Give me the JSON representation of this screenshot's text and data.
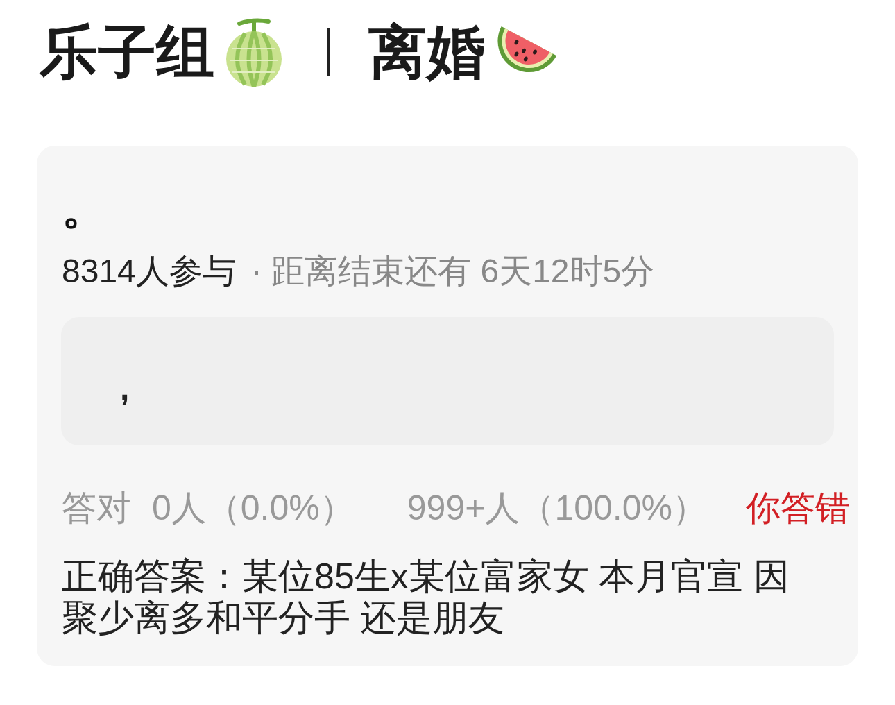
{
  "header": {
    "title": "乐子组",
    "topic": "离婚"
  },
  "quiz": {
    "question": "。",
    "participants": "8314人参与",
    "countdown": "· 距离结束还有 6天12时5分",
    "options": [
      {
        "text": ","
      }
    ],
    "stats": {
      "label": "答对",
      "correct_count": "0人（0.0%）",
      "wrong_count": "999+人（100.0%）",
      "verdict": {
        "text": "你答错",
        "correct": false
      }
    },
    "answer": "正确答案：某位85生x某位富家女 本月官宣 因聚少离多和平分手 还是朋友"
  }
}
